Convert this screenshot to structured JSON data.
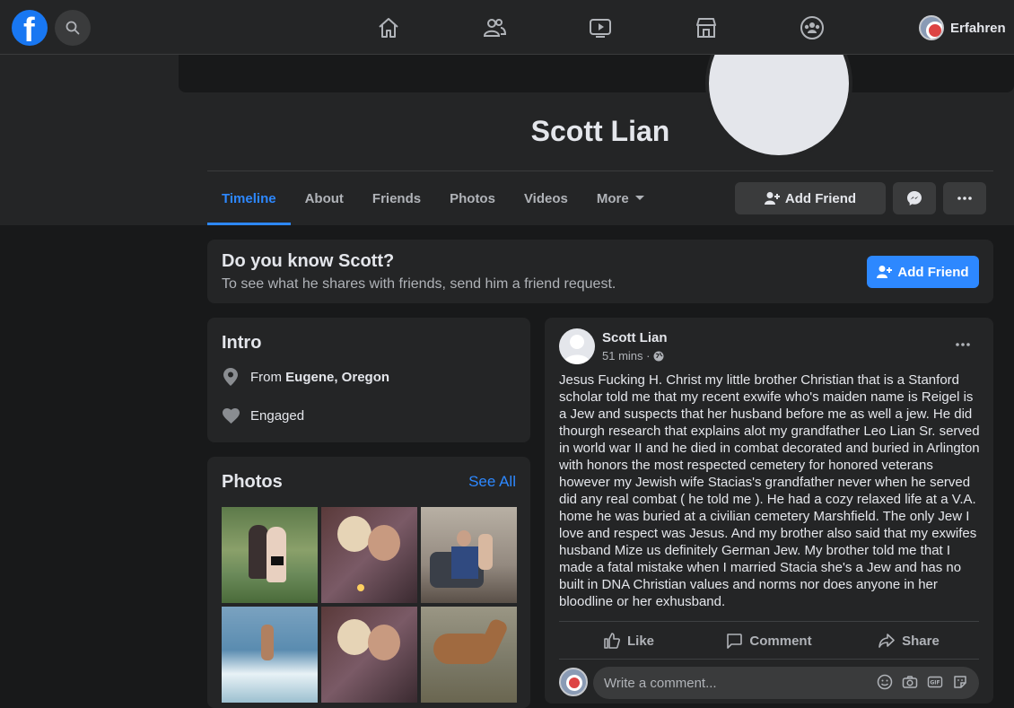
{
  "topbar": {
    "account_name": "Erfahren",
    "nav_icons": [
      "home-icon",
      "friends-icon",
      "watch-icon",
      "marketplace-icon",
      "groups-icon"
    ]
  },
  "profile": {
    "name": "Scott Lian"
  },
  "tabs": [
    {
      "label": "Timeline",
      "active": true
    },
    {
      "label": "About"
    },
    {
      "label": "Friends"
    },
    {
      "label": "Photos"
    },
    {
      "label": "Videos"
    },
    {
      "label": "More"
    }
  ],
  "header_actions": {
    "add_friend": "Add Friend"
  },
  "know_card": {
    "title": "Do you know Scott?",
    "subtitle": "To see what he shares with friends, send him a friend request.",
    "button": "Add Friend"
  },
  "intro": {
    "title": "Intro",
    "from_prefix": "From ",
    "from_place": "Eugene, Oregon",
    "relationship": "Engaged"
  },
  "photos": {
    "title": "Photos",
    "see_all": "See All"
  },
  "post": {
    "author": "Scott Lian",
    "time": "51 mins ·",
    "text": "Jesus Fucking H. Christ my little brother Christian that is a Stanford scholar told me that my recent exwife who's maiden name is Reigel is a Jew and suspects that her husband before me as well a jew. He did thourgh research that explains alot my grandfather Leo Lian Sr. served in world war II and he died in combat decorated and buried in Arlington with honors the most respected cemetery for honored veterans however my Jewish wife Stacias's grandfather never when he served did any real combat ( he told me ). He had a cozy relaxed life at a V.A. home he was buried at a civilian cemetery Marshfield. The only Jew I love and respect was Jesus. And my brother also said that my exwifes husband Mize us definitely German Jew. My brother told me that I made a fatal mistake when I married Stacia she's a Jew and has no built in DNA Christian values and norms nor does anyone in her bloodline or her exhusband.",
    "like": "Like",
    "comment": "Comment",
    "share": "Share",
    "comment_placeholder": "Write a comment..."
  },
  "colors": {
    "accent": "#2d88ff",
    "background": "#18191a",
    "card": "#242526"
  }
}
